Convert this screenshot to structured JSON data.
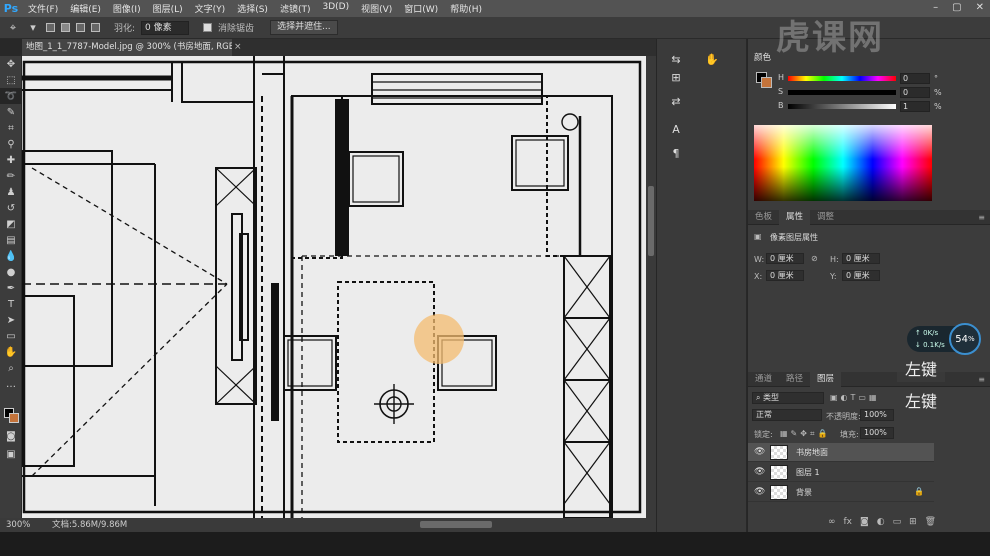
{
  "app": {
    "logo": "Ps"
  },
  "menu": [
    "文件(F)",
    "编辑(E)",
    "图像(I)",
    "图层(L)",
    "文字(Y)",
    "选择(S)",
    "滤镜(T)",
    "3D(D)",
    "视图(V)",
    "窗口(W)",
    "帮助(H)"
  ],
  "options": {
    "feather_label": "羽化:",
    "feather_value": "0 像素",
    "antialias_label": "消除锯齿",
    "select_mask_button": "选择并遮住..."
  },
  "document": {
    "tab_title": "地图_1_1_7787-Model.jpg @ 300% (书房地面, RGB/8#) *"
  },
  "status": {
    "zoom": "300%",
    "doc_size": "文档:5.86M/9.86M"
  },
  "color_panel": {
    "tab": "颜色",
    "sliders": [
      {
        "label": "H",
        "value": "0",
        "unit": "°"
      },
      {
        "label": "S",
        "value": "0",
        "unit": "%"
      },
      {
        "label": "B",
        "value": "1",
        "unit": "%"
      }
    ]
  },
  "props_panel": {
    "tabs": [
      "色板",
      "属性",
      "调整"
    ],
    "active_tab": "属性",
    "heading": "像素图层属性",
    "w_label": "W:",
    "w_value": "0 厘米",
    "h_label": "H:",
    "h_value": "0 厘米",
    "x_label": "X:",
    "x_value": "0 厘米",
    "y_label": "Y:",
    "y_value": "0 厘米",
    "link_icon": "link-icon"
  },
  "layers_panel": {
    "tabs": [
      "通道",
      "路径",
      "图层"
    ],
    "active_tab": "图层",
    "filter_kind": "类型",
    "blend_mode": "正常",
    "opacity_label": "不透明度:",
    "opacity_value": "100%",
    "lock_label": "锁定:",
    "fill_label": "填充:",
    "fill_value": "100%",
    "layers": [
      {
        "name": "书房地面",
        "selected": true
      },
      {
        "name": "图层 1",
        "selected": false
      },
      {
        "name": "背景",
        "selected": false,
        "locked": true
      }
    ]
  },
  "overlays": {
    "net_up": "0",
    "net_up_unit": "K/s",
    "net_down": "0.1",
    "net_down_unit": "K/s",
    "net_percent": "54",
    "net_percent_unit": "%",
    "key_hint_1": "左键",
    "key_hint_2": "左键",
    "watermark": "虎课网"
  },
  "colors": {
    "foreground": "#000000",
    "background": "#c4733a",
    "accent": "#31a8ff"
  }
}
